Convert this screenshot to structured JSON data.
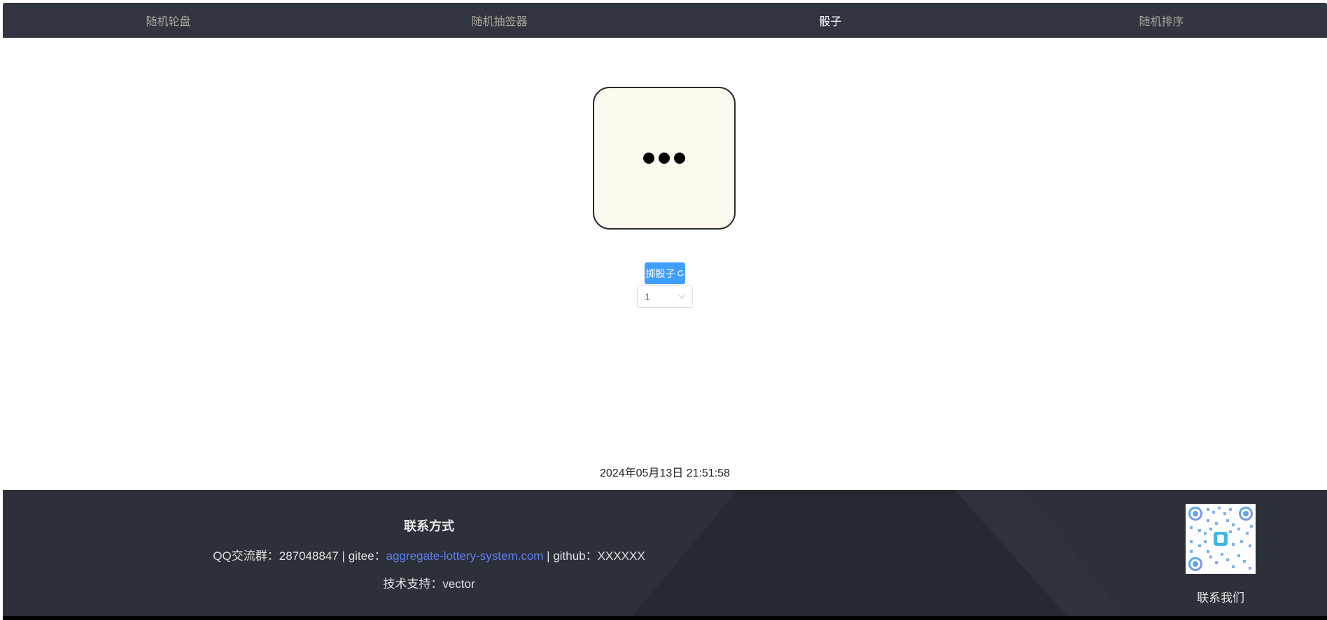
{
  "nav": {
    "tabs": [
      {
        "label": "随机轮盘",
        "active": false
      },
      {
        "label": "随机抽签器",
        "active": false
      },
      {
        "label": "骰子",
        "active": true
      },
      {
        "label": "随机排序",
        "active": false
      }
    ]
  },
  "dice": {
    "value": 3
  },
  "controls": {
    "roll_label": "掷骰子",
    "refresh_icon": "refresh-icon",
    "count_selected": "1"
  },
  "timestamp": "2024年05月13日 21:51:58",
  "footer": {
    "title": "联系方式",
    "qq_label": "QQ交流群：",
    "qq_value": "287048847",
    "sep1": " | ",
    "gitee_label": "gitee：",
    "gitee_link": "aggregate-lottery-system.com",
    "sep2": " | ",
    "github_label": "github：",
    "github_value": "XXXXXX",
    "support_label": "技术支持：",
    "support_value": "vector",
    "contact_us": "联系我们"
  },
  "colors": {
    "nav_bg": "#303540",
    "footer_bg": "#2c3038",
    "button_blue": "#409eff",
    "link_blue": "#5f7df5",
    "dice_bg": "#fdf9ee"
  }
}
